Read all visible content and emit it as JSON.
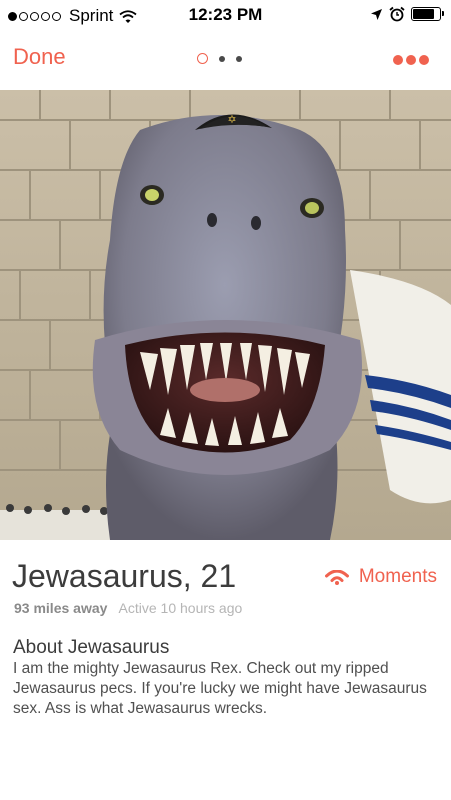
{
  "status_bar": {
    "carrier": "Sprint",
    "time": "12:23 PM",
    "signal_bars": 1,
    "battery_level": 0.8,
    "icons": [
      "wifi-icon",
      "location-arrow-icon",
      "alarm-icon",
      "battery-icon"
    ]
  },
  "nav": {
    "done_label": "Done",
    "photo_count": 3,
    "active_photo_index": 0,
    "more_icon": "ellipsis-icon"
  },
  "profile": {
    "name": "Jewasaurus",
    "separator": ",",
    "age": "21",
    "distance": "93 miles away",
    "active": "Active 10 hours ago",
    "moments_label": "Moments",
    "about_title": "About Jewasaurus",
    "bio": "I am the mighty Jewasaurus Rex. Check out my ripped Jewasaurus pecs. If you're lucky we might have Jewasaurus sex. Ass is what Jewasaurus wrecks."
  },
  "colors": {
    "accent": "#f0624f",
    "text": "#3c3c3c",
    "muted": "#8a8a8a"
  }
}
